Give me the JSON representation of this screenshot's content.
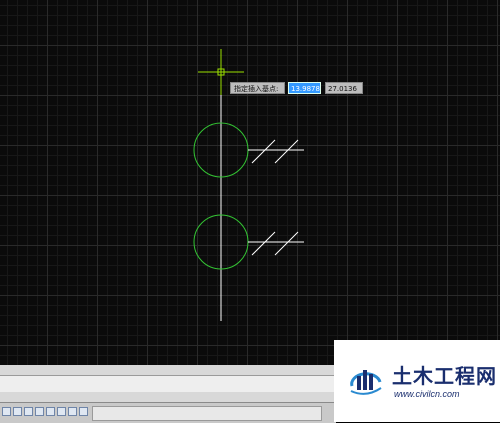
{
  "canvas": {
    "background": "#0b0b0b",
    "grid_minor_color": "#181818",
    "grid_major_color": "#2a2a2a",
    "geometry_color": "#ffffff",
    "circle_color": "#33c433",
    "cursor_color": "#9be000"
  },
  "dynamic_input": {
    "prompt_label": "指定插入基点:",
    "x_value": "13.9878",
    "y_value": "27.0136",
    "active_field_color": "#3399ff"
  },
  "watermark": {
    "title": "土木工程网",
    "url": "www.civilcn.com",
    "brand_color": "#1a2e6e",
    "accent_color": "#2a8ad0"
  }
}
